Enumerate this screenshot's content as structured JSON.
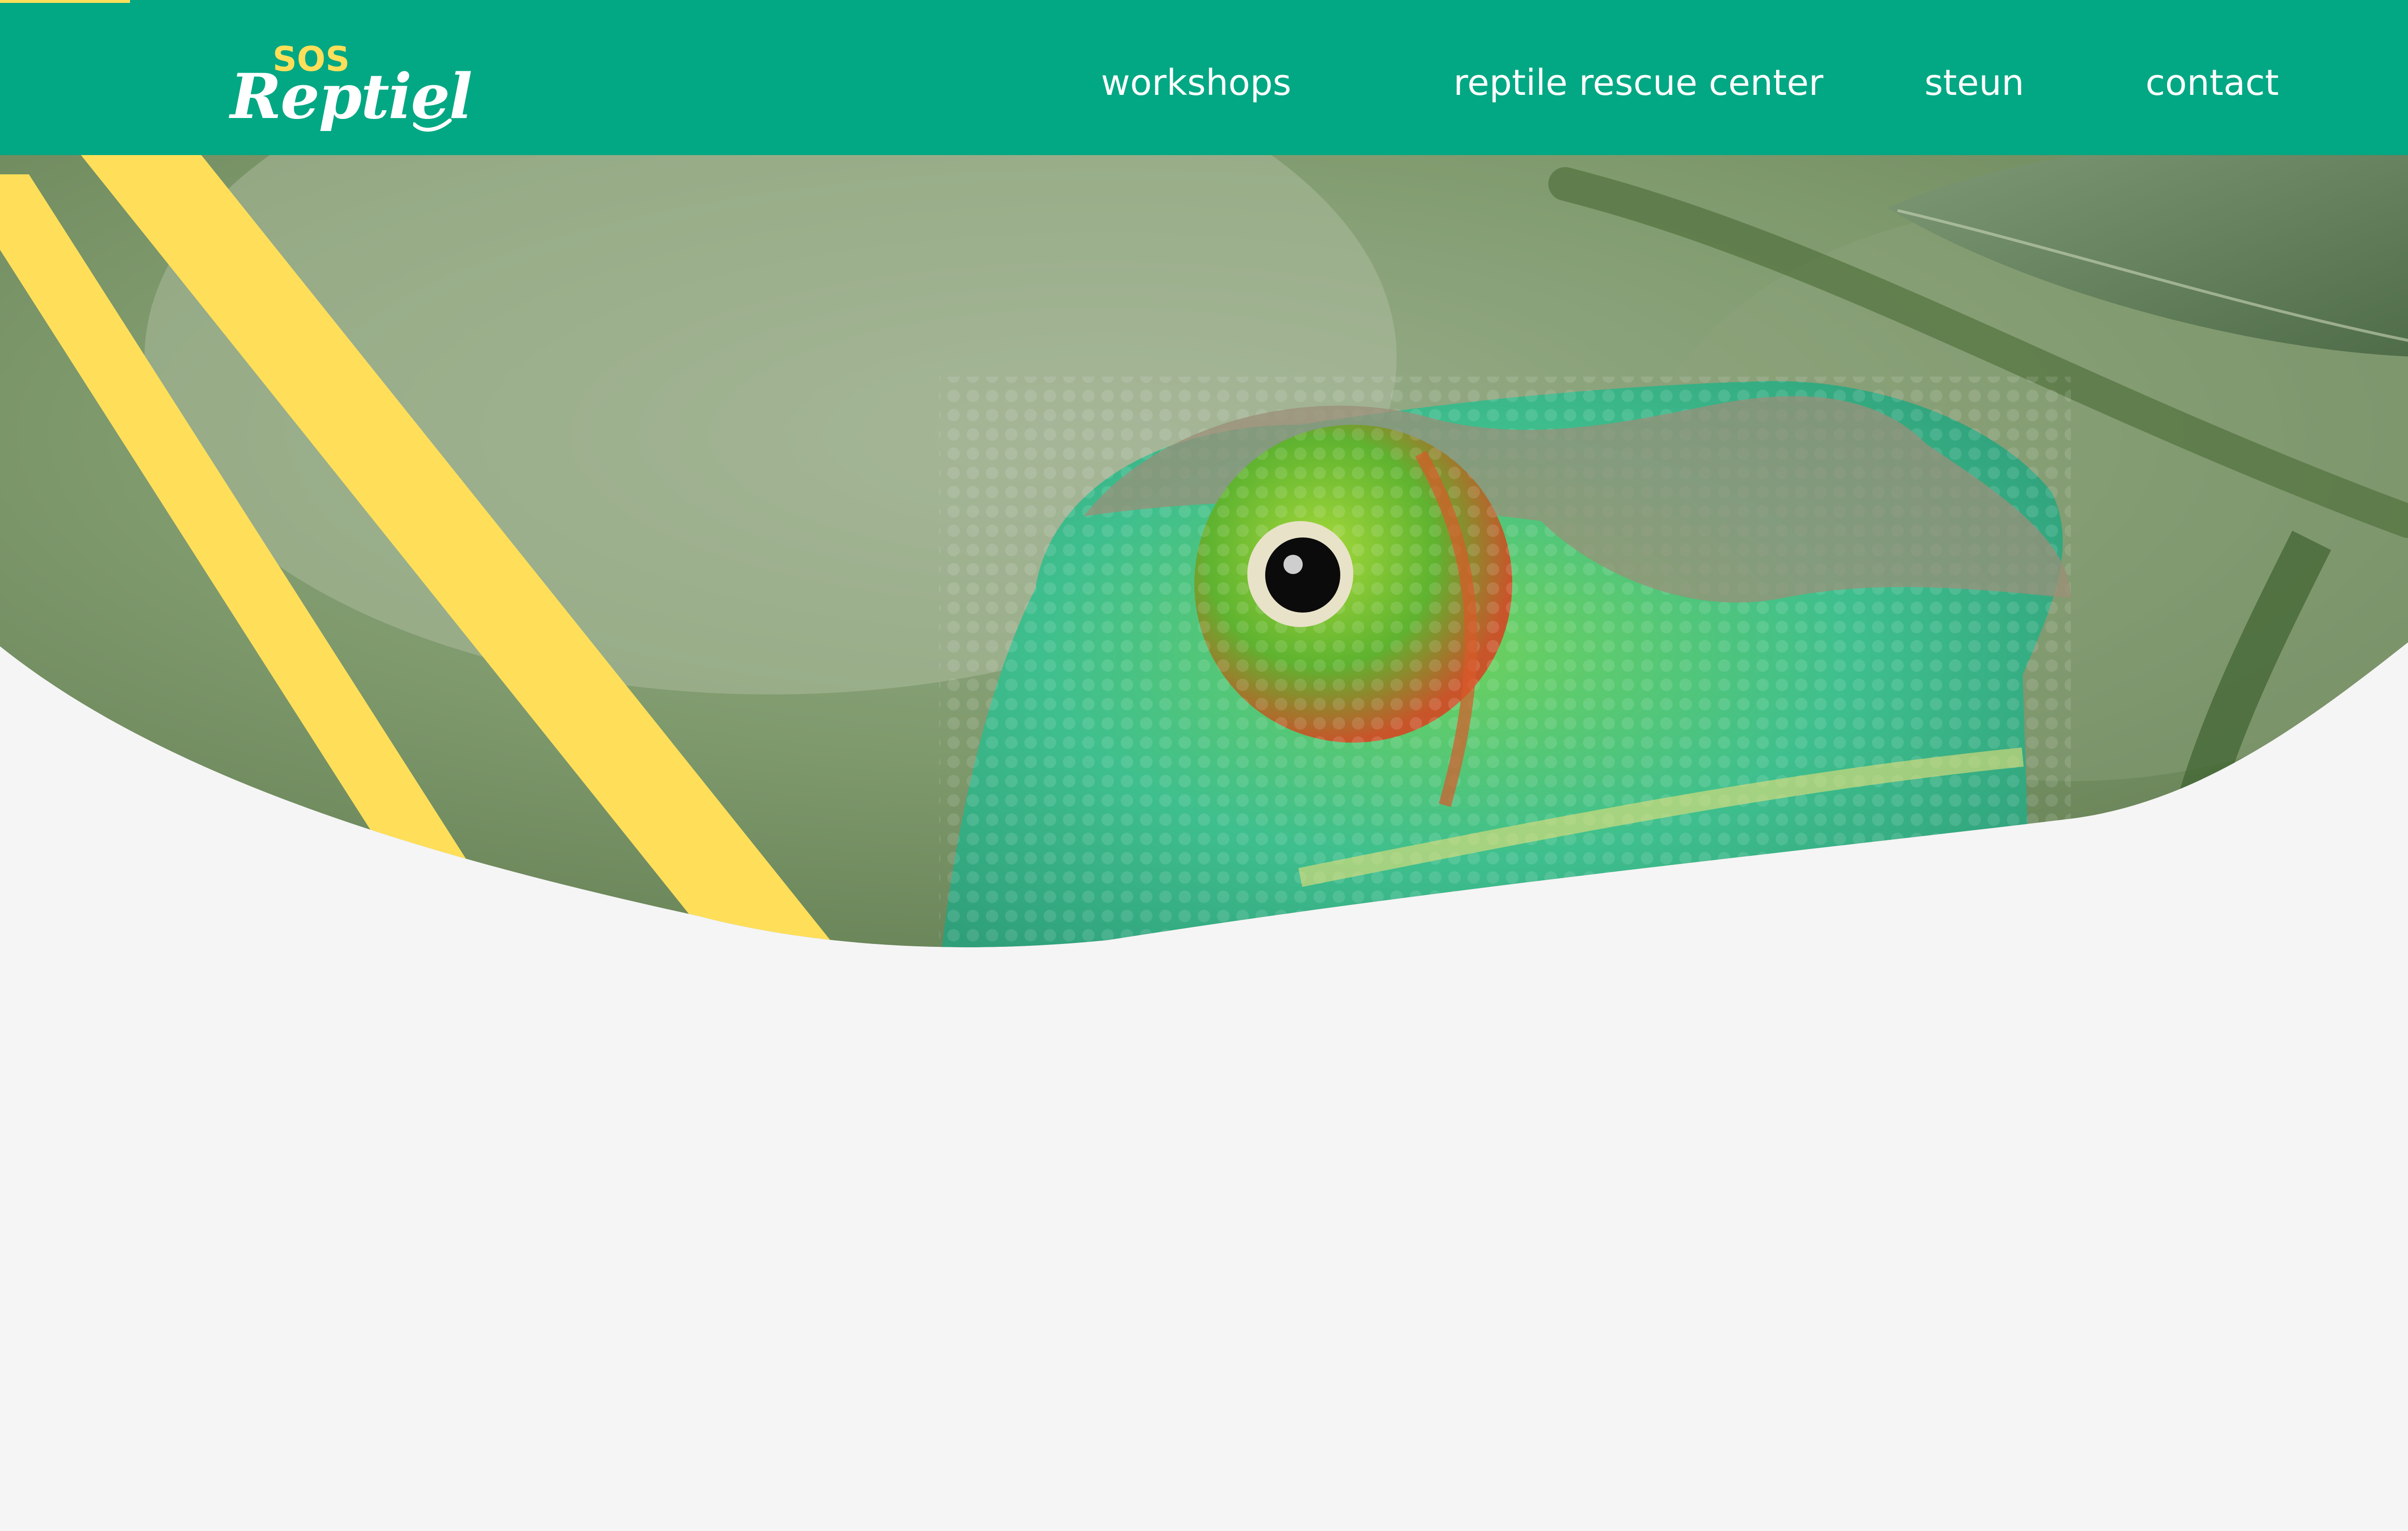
{
  "brand": {
    "name_top": "SOS",
    "name_main": "Reptiel",
    "colors": {
      "header": "#02a883",
      "accent_yellow": "#ffdf5a",
      "background": "#f5f5f5",
      "nav_text": "#ffffff"
    }
  },
  "nav": {
    "items": [
      {
        "label": "workshops"
      },
      {
        "label": "reptile rescue center"
      },
      {
        "label": "steun"
      },
      {
        "label": "contact"
      }
    ]
  },
  "hero": {
    "image_subject": "chameleon-photo",
    "decoration": "yellow-diagonal-stripes"
  }
}
